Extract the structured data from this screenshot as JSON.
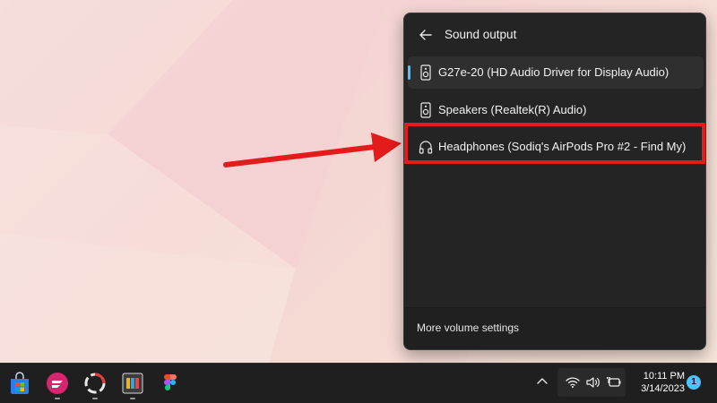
{
  "flyout": {
    "title": "Sound output",
    "devices": [
      {
        "label": "G27e-20 (HD Audio Driver for Display Audio)",
        "icon": "speaker-icon",
        "selected": true
      },
      {
        "label": "Speakers (Realtek(R) Audio)",
        "icon": "speaker-icon",
        "selected": false
      },
      {
        "label": "Headphones (Sodiq's AirPods Pro #2 - Find My)",
        "icon": "headphones-icon",
        "selected": false
      }
    ],
    "footer_link": "More volume settings"
  },
  "taskbar": {
    "apps": [
      "microsoft-store-icon",
      "app-pink-icon",
      "app-ring-icon",
      "app-colorful-icon",
      "figma-icon"
    ],
    "tray_icons": [
      "chevron-up-icon",
      "wifi-icon",
      "volume-icon",
      "battery-icon"
    ],
    "clock": {
      "time": "10:11 PM",
      "date": "3/14/2023"
    },
    "notification_count": "1"
  },
  "colors": {
    "accent": "#4cc2ff",
    "highlight": "#e41b1b",
    "flyout_bg": "#242424",
    "taskbar_bg": "#1f1f1f"
  }
}
